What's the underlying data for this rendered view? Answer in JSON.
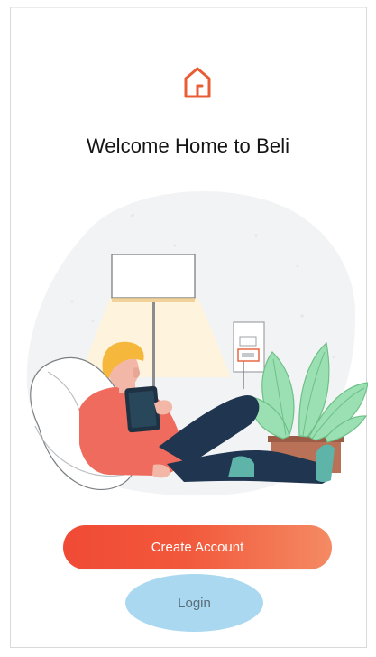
{
  "brand": {
    "logo_icon": "house-icon",
    "accent_color": "#e85c36"
  },
  "welcome": {
    "title": "Welcome Home to Beli"
  },
  "illustration": {
    "icon": "home-lifestyle-illustration"
  },
  "actions": {
    "create_account_label": "Create Account",
    "login_label": "Login",
    "create_account_color": "#f25a3c",
    "login_color": "#a9d8f0"
  }
}
